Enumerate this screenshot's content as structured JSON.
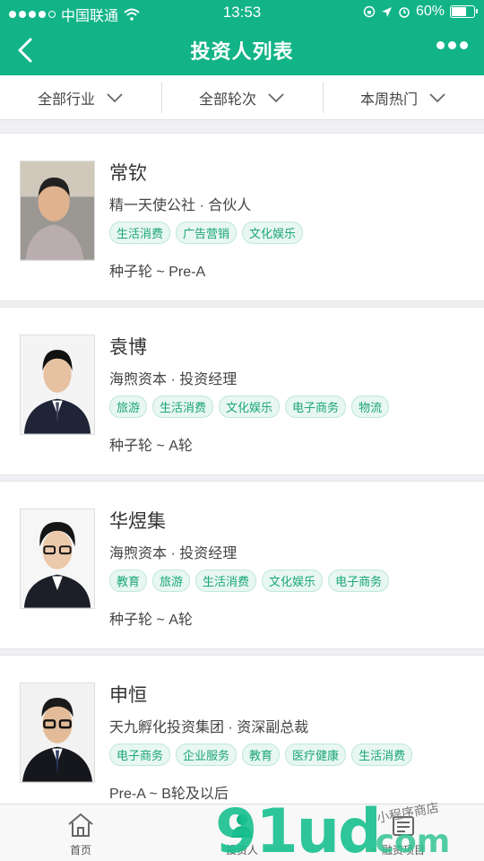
{
  "status_bar": {
    "carrier": "中国联通",
    "time": "13:53",
    "battery_percent": "60%",
    "battery_level": 0.6
  },
  "nav": {
    "title": "投资人列表"
  },
  "filters": [
    {
      "label": "全部行业"
    },
    {
      "label": "全部轮次"
    },
    {
      "label": "本周热门"
    }
  ],
  "investors": [
    {
      "name": "常钦",
      "org": "精一天使公社 · 合伙人",
      "tags": [
        "生活消费",
        "广告营销",
        "文化娱乐"
      ],
      "rounds": "种子轮 ~ Pre-A"
    },
    {
      "name": "袁博",
      "org": "海煦资本 · 投资经理",
      "tags": [
        "旅游",
        "生活消费",
        "文化娱乐",
        "电子商务",
        "物流"
      ],
      "rounds": "种子轮 ~ A轮"
    },
    {
      "name": "华煜集",
      "org": "海煦资本 · 投资经理",
      "tags": [
        "教育",
        "旅游",
        "生活消费",
        "文化娱乐",
        "电子商务"
      ],
      "rounds": "种子轮 ~ A轮"
    },
    {
      "name": "申恒",
      "org": "天九孵化投资集团 · 资深副总裁",
      "tags": [
        "电子商务",
        "企业服务",
        "教育",
        "医疗健康",
        "生活消费"
      ],
      "rounds": "Pre-A ~ B轮及以后"
    }
  ],
  "tabbar": {
    "home": "首页",
    "investors": "投资人",
    "projects": "融资项目"
  },
  "watermark": {
    "main": "91ud",
    "dotcom": ".com",
    "shop": "小程序商店"
  },
  "colors": {
    "brand": "#12b487",
    "tag_text": "#1aa57a"
  }
}
